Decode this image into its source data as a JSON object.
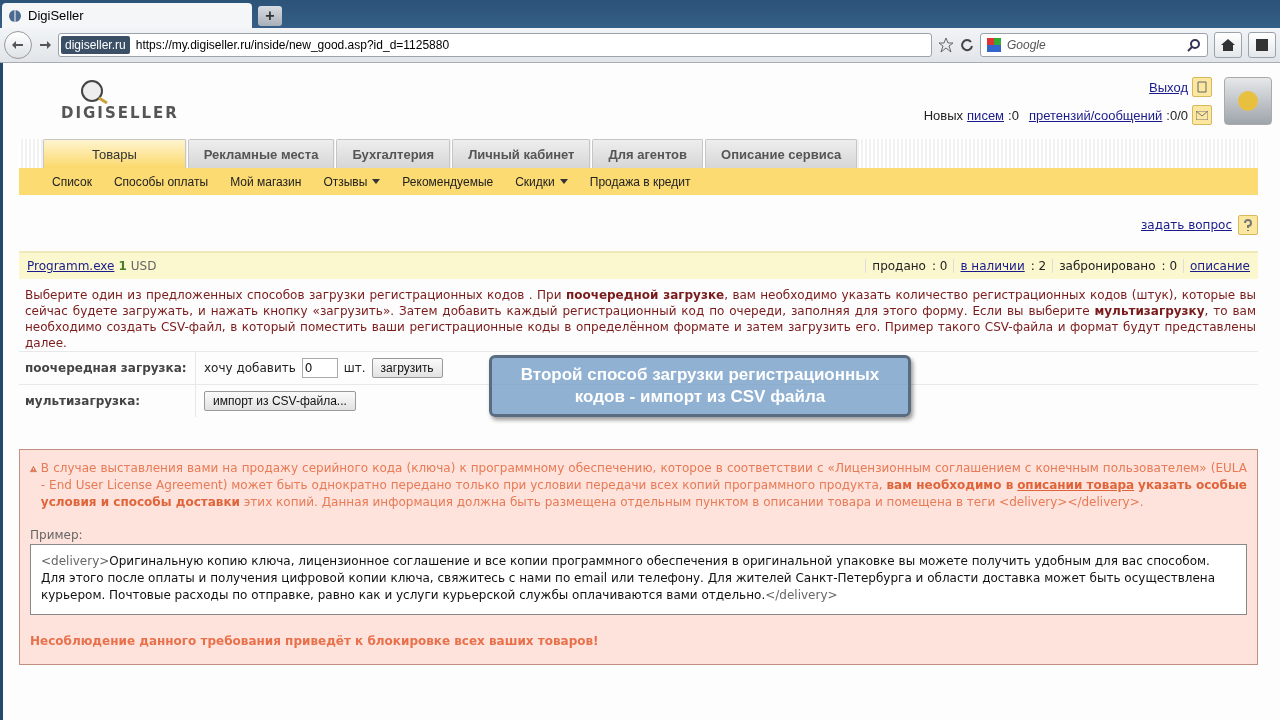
{
  "browser": {
    "tab_title": "DigiSeller",
    "new_tab": "+",
    "site_badge": "digiseller.ru",
    "url": "https://my.digiseller.ru/inside/new_good.asp?id_d=1125880",
    "search_placeholder": "Google"
  },
  "header": {
    "logo": "DIGISELLER",
    "logout": "Выход",
    "new_label": "Новых",
    "letters_link": "писем",
    "letters_count": ":0",
    "claims_link": "претензий/сообщений",
    "claims_count": ":0/0"
  },
  "tabs": [
    {
      "label": "Товары",
      "selected": true
    },
    {
      "label": "Рекламные места",
      "selected": false
    },
    {
      "label": "Бухгалтерия",
      "selected": false
    },
    {
      "label": "Личный кабинет",
      "selected": false
    },
    {
      "label": "Для агентов",
      "selected": false
    },
    {
      "label": "Описание сервиса",
      "selected": false
    }
  ],
  "subnav": [
    {
      "label": "Список",
      "has_menu": false
    },
    {
      "label": "Способы оплаты",
      "has_menu": false
    },
    {
      "label": "Мой магазин",
      "has_menu": false
    },
    {
      "label": "Отзывы",
      "has_menu": true
    },
    {
      "label": "Рекомендуемые",
      "has_menu": false
    },
    {
      "label": "Скидки",
      "has_menu": true
    },
    {
      "label": "Продажа в кредит",
      "has_menu": false
    }
  ],
  "ask_question": "задать вопрос",
  "product": {
    "name": "Programm.exe",
    "price": "1",
    "currency": "USD",
    "stats": [
      {
        "label": "продано",
        "link": false,
        "value": ": 0"
      },
      {
        "label": "в наличии",
        "link": true,
        "value": ": 2"
      },
      {
        "label": "забронировано",
        "link": false,
        "value": ": 0"
      },
      {
        "label": "описание",
        "link": true
      }
    ]
  },
  "intro": "Выберите один из предложенных способов загрузки регистрационных кодов . При **поочередной загрузке**, вам необходимо указать количество регистрационных кодов (штук), которые вы сейчас будете загружать, и нажать кнопку «загрузить». Затем добавить каждый регистрационный код по очереди, заполняя для этого форму. Если вы выберите **мультизагрузку**, то вам необходимо создать CSV-файл, в который поместить ваши регистрационные коды в определённом формате и затем загрузить его. Пример такого CSV-файла и формат будут представлены далее.",
  "upload_rows": [
    {
      "kind": "single",
      "label": "поочередная загрузка:",
      "prefix": "хочу добавить",
      "value": "0",
      "unit": "шт.",
      "button": "загрузить"
    },
    {
      "kind": "multi",
      "label": "мультизагрузка:",
      "button": "импорт из CSV-файла..."
    }
  ],
  "callout": "Второй способ загрузки регистрационных кодов - импорт из CSV файла",
  "warning": {
    "before": "В случае выставления вами на продажу серийного кода (ключа) к программному обеспечению, которое в соответствии с «Лицензионным соглашением с конечным пользователем» (EULA - End User License Agreement) может быть однократно передано только при условии передачи всех копий программного продукта, **вам необходимо в** ",
    "link": "описании товара",
    "after": " **указать особые условия и способы доставки** этих копий. Данная информация должна быть размещена отдельным пунктом в описании товара и помещена в теги <delivery></delivery>.",
    "example_label": "Пример:",
    "example_open": "<delivery>",
    "example_body": "Оригинальную копию ключа, лицензионное соглашение и все копии программного обеспечения в оригинальной упаковке вы можете получить удобным для вас способом. Для этого после оплаты и получения цифровой копии ключа, свяжитесь с нами по email или телефону. Для жителей Санкт-Петербурга и области доставка может быть осуществлена курьером. Почтовые расходы по отправке, равно как и услуги курьерской службы оплачиваются вами отдельно.",
    "example_close": "</delivery>",
    "footer": "Несоблюдение данного требования приведёт к блокировке всех ваших товаров!"
  }
}
